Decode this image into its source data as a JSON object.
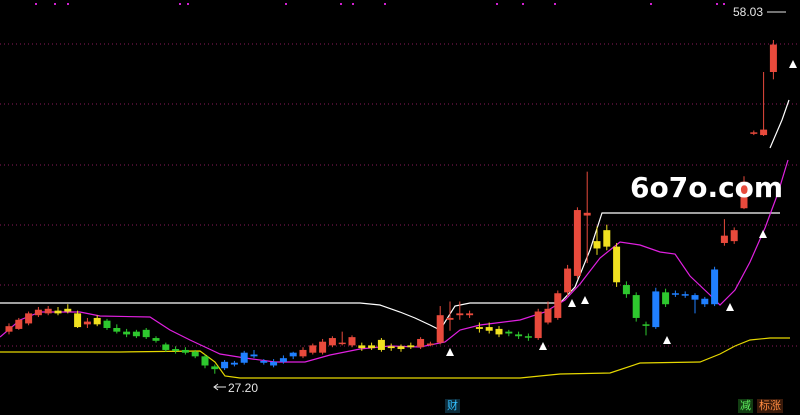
{
  "chart_data": {
    "type": "candlestick",
    "title": "",
    "ylim": [
      20,
      62
    ],
    "grid": "dotted horizontal",
    "candles": [
      {
        "o": 26.6,
        "c": 27.2,
        "h": 27.5,
        "l": 26.3,
        "color": "#e84a3c"
      },
      {
        "o": 26.9,
        "c": 27.9,
        "h": 28.1,
        "l": 26.8,
        "color": "#e84a3c"
      },
      {
        "o": 27.5,
        "c": 28.6,
        "h": 28.8,
        "l": 27.3,
        "color": "#e84a3c"
      },
      {
        "o": 28.4,
        "c": 29.0,
        "h": 29.3,
        "l": 28.2,
        "color": "#e84a3c"
      },
      {
        "o": 28.6,
        "c": 29.1,
        "h": 29.4,
        "l": 28.4,
        "color": "#e84a3c"
      },
      {
        "o": 28.9,
        "c": 28.6,
        "h": 29.3,
        "l": 28.4,
        "color": "#f0e020"
      },
      {
        "o": 28.8,
        "c": 29.1,
        "h": 29.6,
        "l": 28.6,
        "color": "#f0e020"
      },
      {
        "o": 28.6,
        "c": 27.1,
        "h": 28.9,
        "l": 27.0,
        "color": "#f0e020"
      },
      {
        "o": 27.4,
        "c": 27.7,
        "h": 28.1,
        "l": 27.0,
        "color": "#e84a3c"
      },
      {
        "o": 28.1,
        "c": 27.4,
        "h": 28.4,
        "l": 27.2,
        "color": "#f0e020"
      },
      {
        "o": 27.8,
        "c": 27.0,
        "h": 28.0,
        "l": 26.8,
        "color": "#2ec82e"
      },
      {
        "o": 27.0,
        "c": 26.6,
        "h": 27.4,
        "l": 26.4,
        "color": "#2ec82e"
      },
      {
        "o": 26.6,
        "c": 26.3,
        "h": 26.9,
        "l": 26.0,
        "color": "#2ec82e"
      },
      {
        "o": 26.6,
        "c": 26.1,
        "h": 26.8,
        "l": 25.9,
        "color": "#2ec82e"
      },
      {
        "o": 26.8,
        "c": 26.0,
        "h": 27.0,
        "l": 25.8,
        "color": "#2ec82e"
      },
      {
        "o": 25.9,
        "c": 25.6,
        "h": 26.1,
        "l": 25.4,
        "color": "#2ec82e"
      },
      {
        "o": 25.2,
        "c": 24.6,
        "h": 25.4,
        "l": 24.4,
        "color": "#2ec82e"
      },
      {
        "o": 24.7,
        "c": 24.5,
        "h": 25.0,
        "l": 24.2,
        "color": "#2ec82e"
      },
      {
        "o": 24.6,
        "c": 24.3,
        "h": 24.9,
        "l": 24.1,
        "color": "#2ec82e"
      },
      {
        "o": 24.4,
        "c": 23.9,
        "h": 24.6,
        "l": 23.7,
        "color": "#2ec82e"
      },
      {
        "o": 23.9,
        "c": 22.9,
        "h": 24.1,
        "l": 22.6,
        "color": "#2ec82e"
      },
      {
        "o": 22.8,
        "c": 22.5,
        "h": 23.0,
        "l": 22.0,
        "color": "#2ec82e"
      },
      {
        "o": 22.6,
        "c": 23.3,
        "h": 23.5,
        "l": 22.4,
        "color": "#2080ff"
      },
      {
        "o": 23.2,
        "c": 23.0,
        "h": 23.4,
        "l": 22.8,
        "color": "#2080ff"
      },
      {
        "o": 23.2,
        "c": 24.3,
        "h": 24.5,
        "l": 23.0,
        "color": "#2080ff"
      },
      {
        "o": 23.9,
        "c": 24.1,
        "h": 24.6,
        "l": 23.7,
        "color": "#2080ff"
      },
      {
        "o": 23.4,
        "c": 23.2,
        "h": 23.6,
        "l": 23.0,
        "color": "#2080ff"
      },
      {
        "o": 23.3,
        "c": 22.9,
        "h": 23.6,
        "l": 22.7,
        "color": "#2080ff"
      },
      {
        "o": 23.3,
        "c": 23.7,
        "h": 24.0,
        "l": 23.1,
        "color": "#2080ff"
      },
      {
        "o": 24.3,
        "c": 23.9,
        "h": 24.4,
        "l": 23.6,
        "color": "#2080ff"
      },
      {
        "o": 23.9,
        "c": 24.6,
        "h": 24.9,
        "l": 23.7,
        "color": "#e84a3c"
      },
      {
        "o": 24.3,
        "c": 25.1,
        "h": 25.3,
        "l": 24.1,
        "color": "#e84a3c"
      },
      {
        "o": 24.3,
        "c": 25.5,
        "h": 25.8,
        "l": 24.1,
        "color": "#e84a3c"
      },
      {
        "o": 25.1,
        "c": 25.9,
        "h": 26.1,
        "l": 24.9,
        "color": "#e84a3c"
      },
      {
        "o": 25.3,
        "c": 25.4,
        "h": 26.6,
        "l": 25.1,
        "color": "#e84a3c"
      },
      {
        "o": 25.1,
        "c": 26.0,
        "h": 26.2,
        "l": 24.9,
        "color": "#e84a3c"
      },
      {
        "o": 25.1,
        "c": 24.8,
        "h": 25.4,
        "l": 24.5,
        "color": "#f0e020"
      },
      {
        "o": 25.1,
        "c": 24.8,
        "h": 25.4,
        "l": 24.6,
        "color": "#f0e020"
      },
      {
        "o": 25.7,
        "c": 24.6,
        "h": 25.9,
        "l": 24.4,
        "color": "#f0e020"
      },
      {
        "o": 25.0,
        "c": 24.8,
        "h": 25.3,
        "l": 24.5,
        "color": "#f0e020"
      },
      {
        "o": 25.0,
        "c": 24.7,
        "h": 25.2,
        "l": 24.4,
        "color": "#f0e020"
      },
      {
        "o": 25.1,
        "c": 24.9,
        "h": 25.4,
        "l": 24.7,
        "color": "#f0e020"
      },
      {
        "o": 24.9,
        "c": 25.8,
        "h": 26.0,
        "l": 24.7,
        "color": "#e84a3c"
      },
      {
        "o": 25.2,
        "c": 25.3,
        "h": 25.5,
        "l": 25.0,
        "color": "#e84a3c"
      },
      {
        "o": 25.4,
        "c": 28.4,
        "h": 29.4,
        "l": 25.2,
        "color": "#e84a3c"
      },
      {
        "o": 27.9,
        "c": 28.1,
        "h": 29.9,
        "l": 26.7,
        "color": "#e84a3c"
      },
      {
        "o": 28.4,
        "c": 28.6,
        "h": 29.9,
        "l": 27.9,
        "color": "#e84a3c"
      },
      {
        "o": 28.4,
        "c": 28.6,
        "h": 28.9,
        "l": 28.1,
        "color": "#e84a3c"
      },
      {
        "o": 27.1,
        "c": 26.9,
        "h": 27.6,
        "l": 26.5,
        "color": "#f0e020"
      },
      {
        "o": 27.1,
        "c": 26.7,
        "h": 27.6,
        "l": 26.4,
        "color": "#f0e020"
      },
      {
        "o": 26.9,
        "c": 26.3,
        "h": 27.2,
        "l": 26.0,
        "color": "#f0e020"
      },
      {
        "o": 26.6,
        "c": 26.4,
        "h": 26.8,
        "l": 26.1,
        "color": "#2ec82e"
      },
      {
        "o": 26.3,
        "c": 26.1,
        "h": 26.6,
        "l": 25.8,
        "color": "#2ec82e"
      },
      {
        "o": 26.1,
        "c": 26.0,
        "h": 26.4,
        "l": 25.6,
        "color": "#2ec82e"
      },
      {
        "o": 25.9,
        "c": 28.8,
        "h": 29.1,
        "l": 25.7,
        "color": "#e84a3c"
      },
      {
        "o": 27.6,
        "c": 29.1,
        "h": 29.9,
        "l": 27.4,
        "color": "#e84a3c"
      },
      {
        "o": 28.1,
        "c": 30.8,
        "h": 31.1,
        "l": 27.9,
        "color": "#e84a3c"
      },
      {
        "o": 30.9,
        "c": 33.5,
        "h": 33.9,
        "l": 30.5,
        "color": "#e84a3c"
      },
      {
        "o": 32.7,
        "c": 39.9,
        "h": 40.2,
        "l": 32.4,
        "color": "#e84a3c"
      },
      {
        "o": 39.3,
        "c": 39.6,
        "h": 44.1,
        "l": 34.1,
        "color": "#e84a3c"
      },
      {
        "o": 36.5,
        "c": 35.7,
        "h": 38.1,
        "l": 35.0,
        "color": "#f0e020"
      },
      {
        "o": 37.7,
        "c": 35.9,
        "h": 38.3,
        "l": 35.5,
        "color": "#f0e020"
      },
      {
        "o": 35.9,
        "c": 32.0,
        "h": 36.3,
        "l": 31.5,
        "color": "#f0e020"
      },
      {
        "o": 31.7,
        "c": 30.7,
        "h": 32.1,
        "l": 30.3,
        "color": "#2ec82e"
      },
      {
        "o": 30.6,
        "c": 28.1,
        "h": 30.9,
        "l": 27.7,
        "color": "#2ec82e"
      },
      {
        "o": 27.4,
        "c": 27.3,
        "h": 27.7,
        "l": 26.2,
        "color": "#2ec82e"
      },
      {
        "o": 31.0,
        "c": 27.1,
        "h": 31.4,
        "l": 26.9,
        "color": "#2080ff"
      },
      {
        "o": 30.9,
        "c": 29.6,
        "h": 31.3,
        "l": 29.3,
        "color": "#2ec82e"
      },
      {
        "o": 30.7,
        "c": 30.8,
        "h": 31.1,
        "l": 30.4,
        "color": "#2080ff"
      },
      {
        "o": 30.7,
        "c": 30.6,
        "h": 31.0,
        "l": 30.3,
        "color": "#2080ff"
      },
      {
        "o": 30.6,
        "c": 30.1,
        "h": 30.8,
        "l": 28.6,
        "color": "#2080ff"
      },
      {
        "o": 30.2,
        "c": 29.6,
        "h": 30.4,
        "l": 29.3,
        "color": "#2080ff"
      },
      {
        "o": 29.6,
        "c": 33.4,
        "h": 33.7,
        "l": 29.4,
        "color": "#2080ff"
      },
      {
        "o": 36.3,
        "c": 37.1,
        "h": 38.9,
        "l": 36.0,
        "color": "#e84a3c"
      },
      {
        "o": 36.5,
        "c": 37.7,
        "h": 38.0,
        "l": 36.2,
        "color": "#e84a3c"
      },
      {
        "o": 40.1,
        "c": 43.0,
        "h": 43.6,
        "l": 40.0,
        "color": "#e84a3c"
      },
      {
        "o": 48.3,
        "c": 48.4,
        "h": 48.6,
        "l": 48.1,
        "color": "#e84a3c"
      },
      {
        "o": 48.1,
        "c": 48.7,
        "h": 55.0,
        "l": 48.0,
        "color": "#e84a3c"
      },
      {
        "o": 55.0,
        "c": 58.0,
        "h": 58.5,
        "l": 54.2,
        "color": "#e84a3c"
      }
    ],
    "max_label": "58.03",
    "min_label": "27.20",
    "bottom_tags": {
      "cai": "财",
      "jian": "减",
      "zhang": "标涨"
    }
  },
  "watermark": "6o7o.com",
  "colors": {
    "background": "#000000",
    "up": "#e84a3c",
    "down": "#2ec82e",
    "neutral": "#f0e020",
    "blue": "#2080ff",
    "magenta_line": "#e020e0",
    "white_line": "#ffffff",
    "yellow_line": "#e6d800",
    "grid": "#8a1a5a"
  }
}
